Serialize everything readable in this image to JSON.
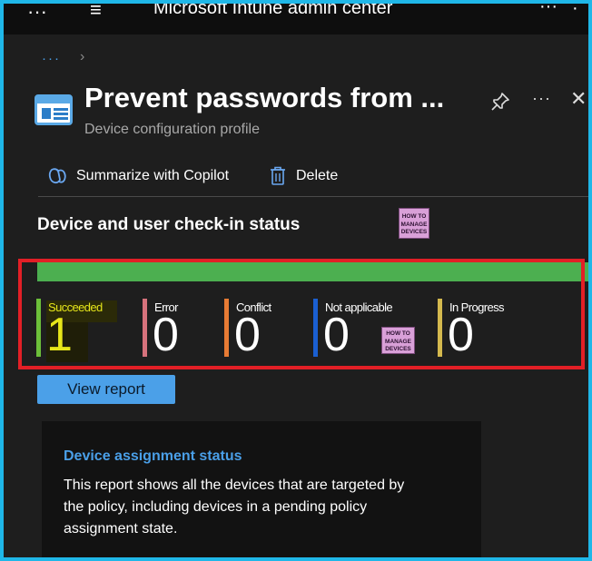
{
  "app": {
    "title": "Microsoft Intune admin center",
    "menu_dots": "···",
    "menu_glyph": "≡",
    "top_right_1": "···",
    "top_right_2": "·"
  },
  "breadcrumb": {
    "ellipsis": "···",
    "chevron": "›"
  },
  "header": {
    "title": "Prevent passwords from ...",
    "subtitle": "Device configuration profile",
    "more_label": "···",
    "close_label": "✕",
    "icons": [
      "profile-icon",
      "pin-icon",
      "more-icon",
      "close-icon"
    ]
  },
  "commands": {
    "copilot_label": "Summarize with Copilot",
    "delete_label": "Delete",
    "icons": [
      "copilot-icon",
      "trash-icon"
    ]
  },
  "checkin": {
    "title": "Device and user check-in status",
    "bar_color": "#4caf50",
    "stats": [
      {
        "label": "Succeeded",
        "value": "1",
        "color": "#6cbf3a"
      },
      {
        "label": "Error",
        "value": "0",
        "color": "#d6727c"
      },
      {
        "label": "Conflict",
        "value": "0",
        "color": "#e87b34"
      },
      {
        "label": "Not applicable",
        "value": "0",
        "color": "#1a5fd1"
      },
      {
        "label": "In Progress",
        "value": "0",
        "color": "#d4b94e"
      }
    ],
    "highlight_color": "#e6e61a"
  },
  "watermark": {
    "line1": "HOW TO",
    "line2": "MANAGE",
    "line3": "DEVICES"
  },
  "view_report": {
    "label": "View report"
  },
  "assignment_card": {
    "title": "Device assignment status",
    "description": "This report shows all the devices that are targeted by the policy, including devices in a pending policy assignment state."
  },
  "colors": {
    "accent": "#4ba0e8",
    "border_frame": "#1fb7e8",
    "annotation_red": "#e21f26"
  }
}
